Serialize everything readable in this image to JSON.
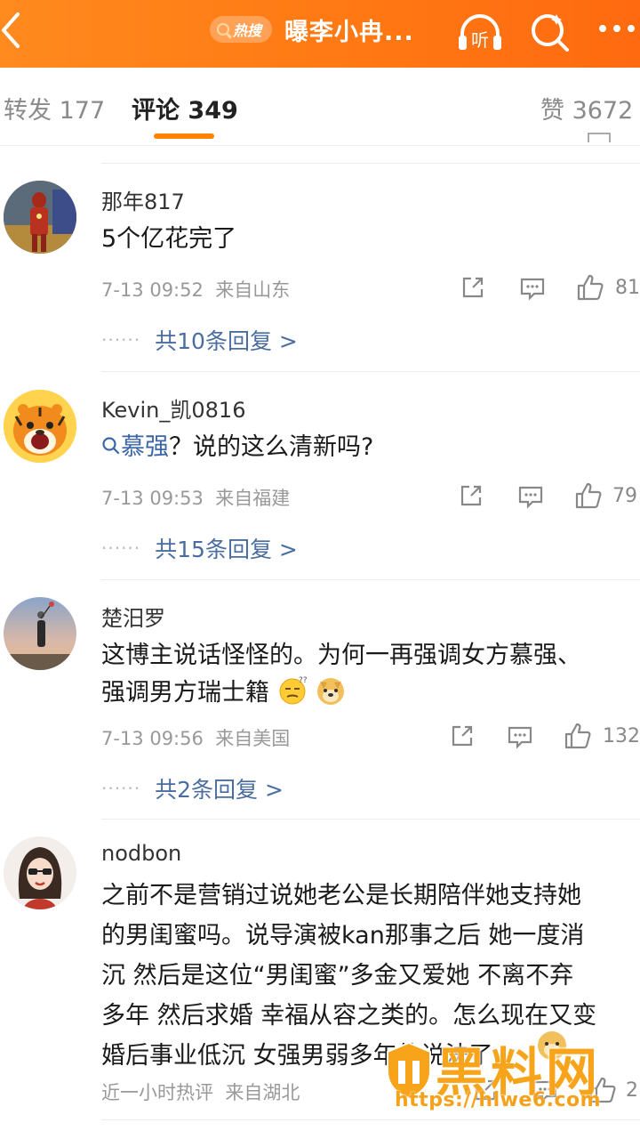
{
  "header": {
    "hot_badge": "热搜",
    "title": "曝李小冉...",
    "listen_label": "听",
    "colors": {
      "bar": "#ff7a14",
      "accent": "#ff8200",
      "link": "#4a6da0"
    }
  },
  "tabs": [
    {
      "label": "转发",
      "count": "177"
    },
    {
      "label": "评论",
      "count": "349"
    },
    {
      "label": "赞",
      "count": "3672"
    }
  ],
  "comments": [
    {
      "user": "那年817",
      "text": "5个亿花完了",
      "time": "7-13 09:52",
      "location": "来自山东",
      "likes": "81",
      "replies": "共10条回复 >"
    },
    {
      "user": "Kevin_凯0816",
      "keyword": "慕强",
      "text": "？说的这么清新吗?",
      "time": "7-13 09:53",
      "location": "来自福建",
      "likes": "79",
      "replies": "共15条回复 >"
    },
    {
      "user": "楚汨罗",
      "text_line1": "这博主说话怪怪的。为何一再强调女方慕强、",
      "text_line2": "强调男方瑞士籍",
      "time": "7-13 09:56",
      "location": "来自美国",
      "likes": "132",
      "replies": "共2条回复 >"
    },
    {
      "user": "nodbon",
      "lines": [
        "之前不是营销过说她老公是长期陪伴她支持她",
        "的男闺蜜吗。说导演被kan那事之后 她一度消",
        "沉 然后是这位“男闺蜜”多金又爱她 不离不弃",
        "多年 然后求婚 幸福从容之类的。怎么现在又变",
        "婚后事业低沉 女强男弱多年的说法了"
      ],
      "time": "近一小时热评",
      "location": "来自湖北",
      "likes": "2"
    }
  ],
  "reply_dots": "······",
  "watermark": {
    "text": "黑料网",
    "url": "https://hlwe6.com"
  }
}
